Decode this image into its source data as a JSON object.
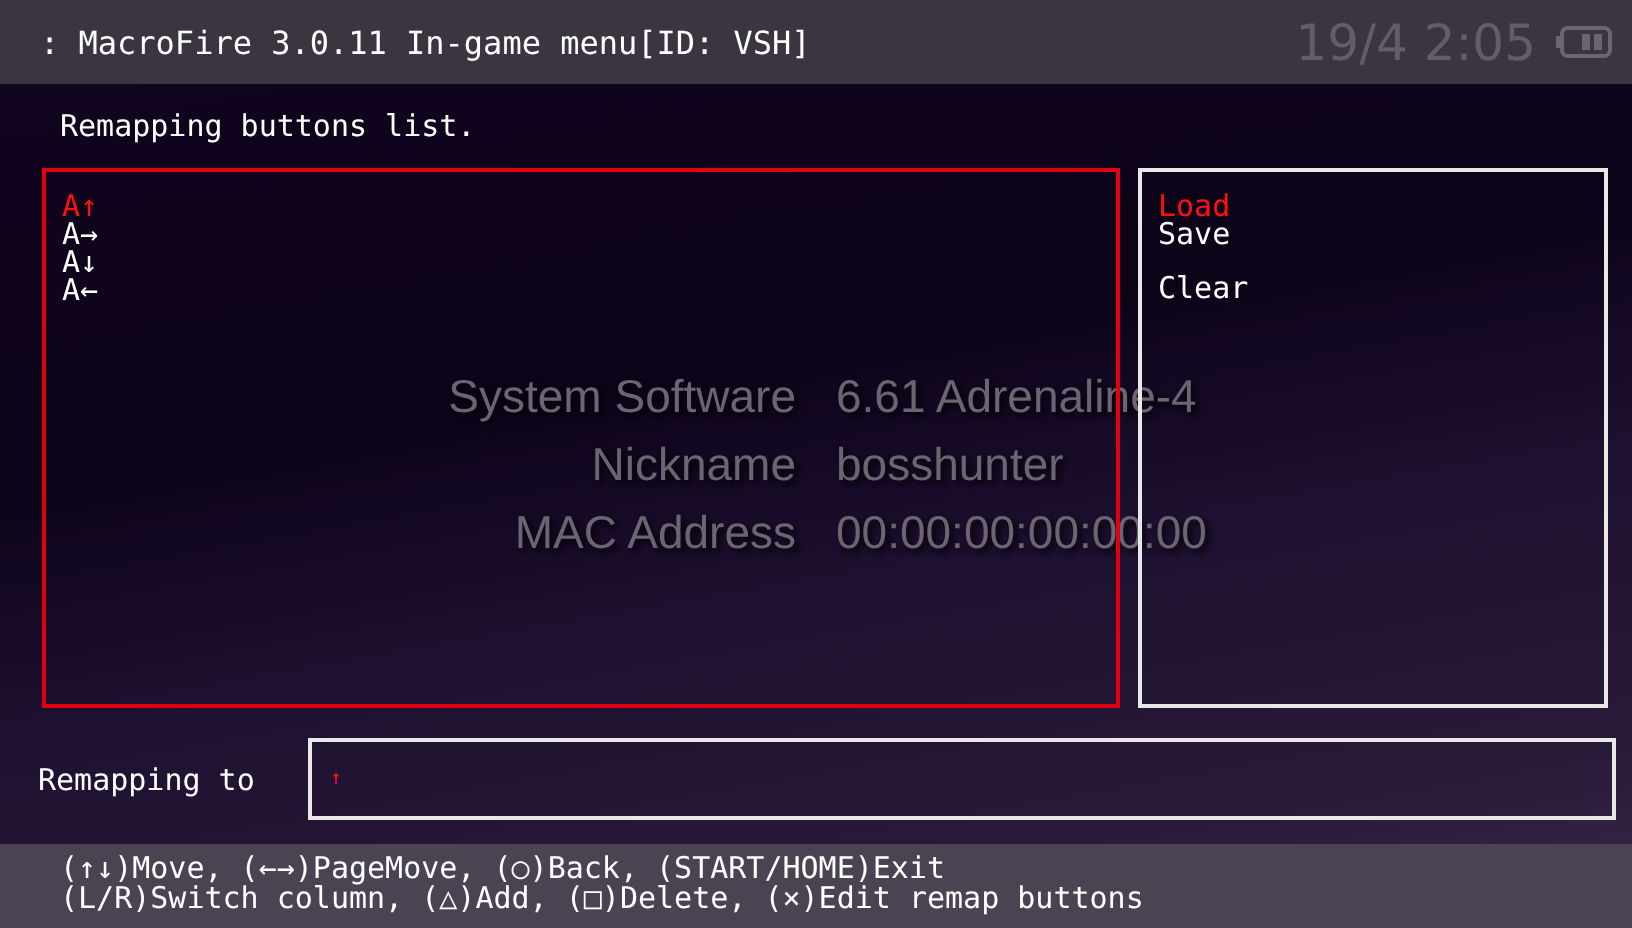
{
  "header": {
    "title": ": MacroFire 3.0.11 In-game menu[ID: VSH]",
    "clock": "19/4 2:05"
  },
  "subtitle": "Remapping buttons list.",
  "remap_list": [
    {
      "label": "A↑",
      "selected": true
    },
    {
      "label": "A→",
      "selected": false
    },
    {
      "label": "A↓",
      "selected": false
    },
    {
      "label": "A←",
      "selected": false
    }
  ],
  "menu_groups": [
    [
      {
        "label": "Load",
        "selected": true
      },
      {
        "label": "Save",
        "selected": false
      }
    ],
    [
      {
        "label": "Clear",
        "selected": false
      }
    ]
  ],
  "system_info": [
    {
      "label": "System Software",
      "value": "6.61 Adrenaline-4"
    },
    {
      "label": "Nickname",
      "value": "bosshunter"
    },
    {
      "label": "MAC Address",
      "value": "00:00:00:00:00:00"
    }
  ],
  "remapping_to": {
    "label": "Remapping to",
    "value": "↑"
  },
  "help_lines": [
    "(↑↓)Move, (←→)PageMove, (○)Back, (START/HOME)Exit",
    "(L/R)Switch column, (△)Add, (□)Delete, (×)Edit remap buttons"
  ]
}
